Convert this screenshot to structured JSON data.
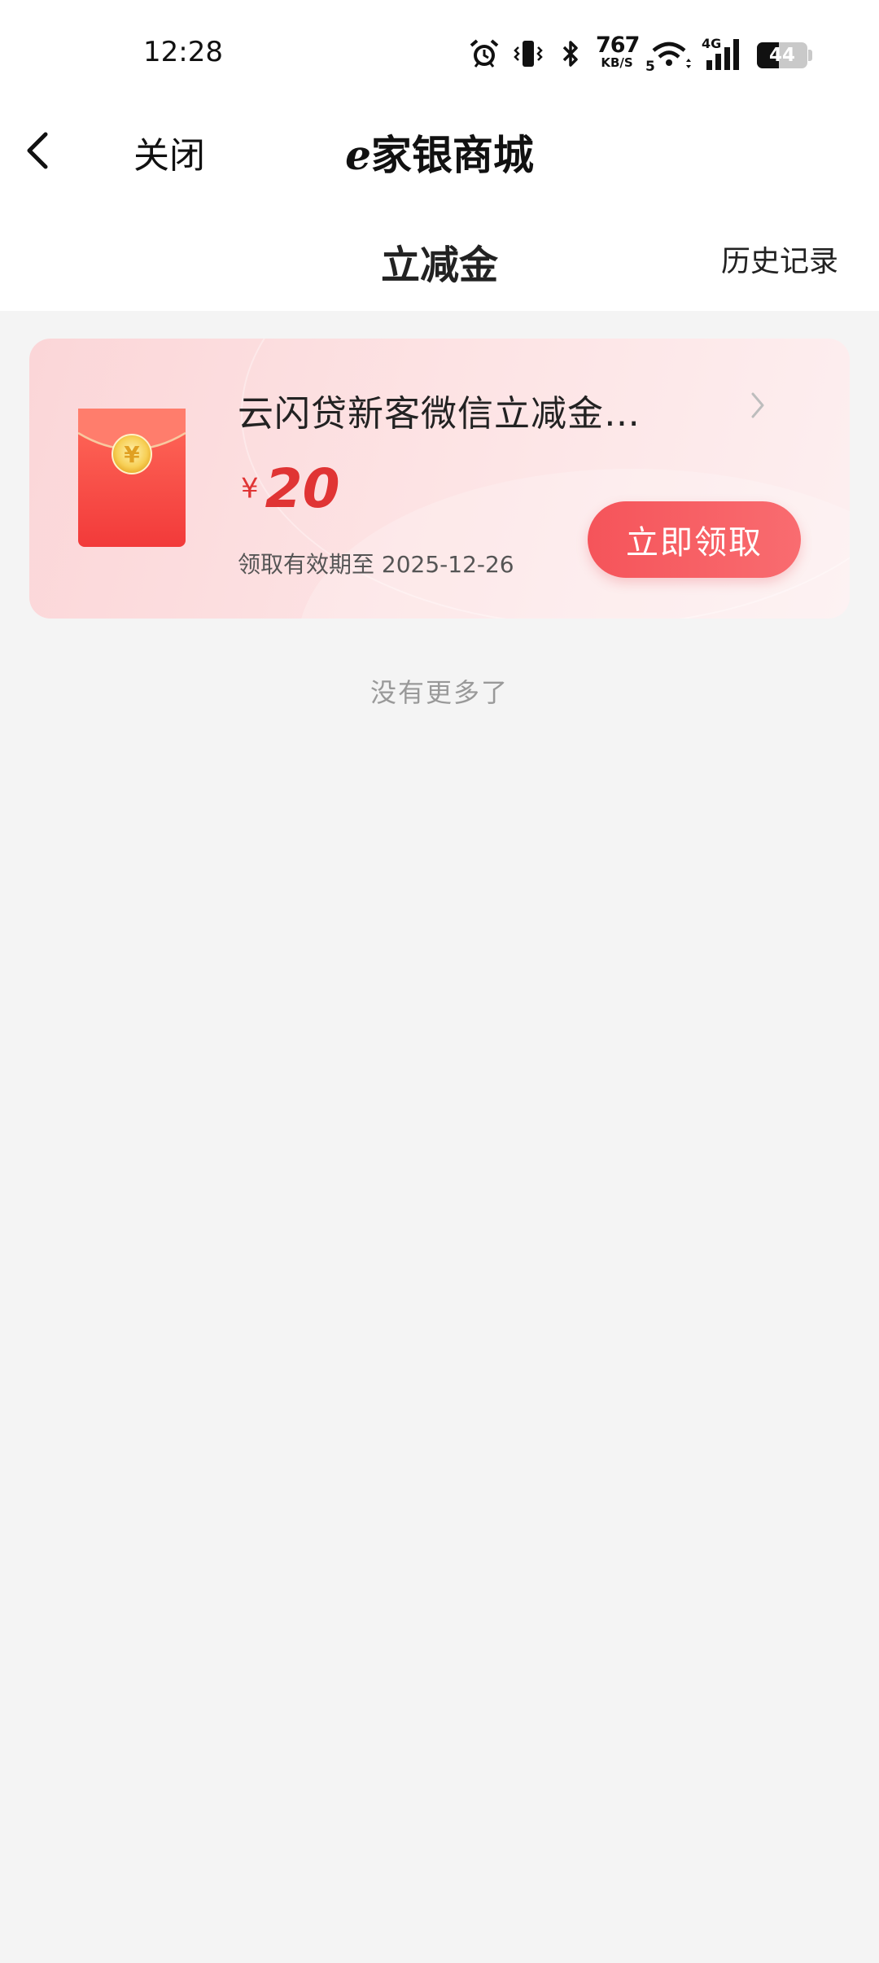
{
  "status_bar": {
    "time": "12:28",
    "net_speed": "767",
    "net_speed_unit": "KB/S",
    "signal_label": "4G",
    "wifi_sub_label": "5",
    "battery_level": "44",
    "icons": [
      "alarm-icon",
      "vibrate-icon",
      "bluetooth-icon",
      "wifi-icon",
      "signal-icon",
      "battery-icon"
    ]
  },
  "nav": {
    "back_icon": "chevron-left-icon",
    "close_label": "关闭",
    "title_prefix": "e",
    "title_rest": "家银商城"
  },
  "page": {
    "title": "立减金",
    "history_label": "历史记录"
  },
  "coupons": [
    {
      "title": "云闪贷新客微信立减金…",
      "currency": "¥",
      "amount": "20",
      "validity": "领取有效期至 2025-12-26",
      "claim_label": "立即领取",
      "envelope_symbol": "¥"
    }
  ],
  "footer": {
    "no_more": "没有更多了"
  },
  "colors": {
    "accent": "#e03434",
    "button": "#f5545a",
    "card_bg": "#fde3e4",
    "page_bg": "#f4f4f4"
  }
}
